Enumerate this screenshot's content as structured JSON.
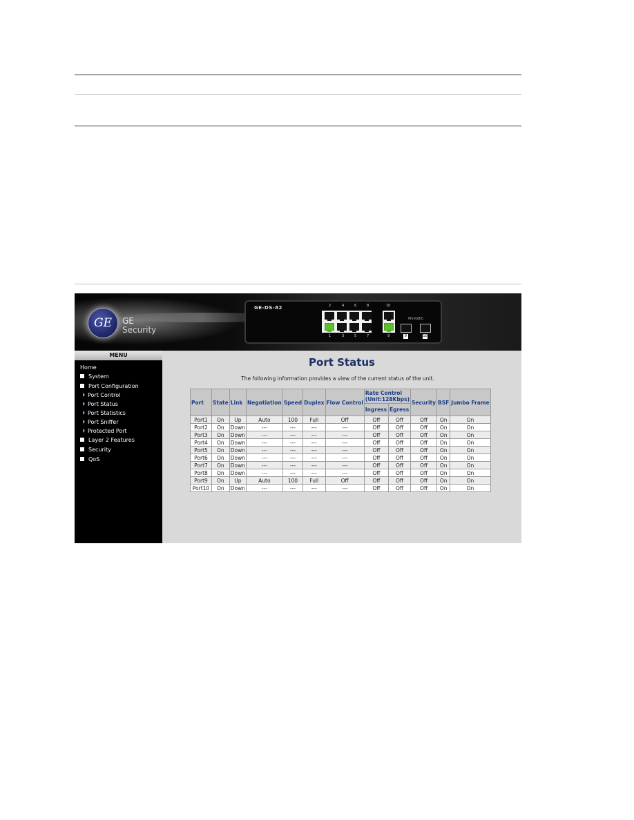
{
  "banner": {
    "logo_text": "GE",
    "brand_line1": "GE",
    "brand_line2": "Security",
    "device_model": "GE-DS-82",
    "top_port_numbers": [
      "2",
      "4",
      "6",
      "8",
      "10"
    ],
    "bottom_port_numbers": [
      "1",
      "3",
      "5",
      "7",
      "9"
    ],
    "gbic_label": "MiniGBIC",
    "sfp_labels": [
      "9",
      "10"
    ],
    "active_ports": [
      1,
      9
    ],
    "active_color": "#5cc22a"
  },
  "menu": {
    "header": "MENU",
    "items": [
      {
        "label": "Home",
        "type": "root"
      },
      {
        "label": "System",
        "type": "collapsed"
      },
      {
        "label": "Port Configuration",
        "type": "expanded"
      },
      {
        "label": "Port Control",
        "type": "sub"
      },
      {
        "label": "Port Status",
        "type": "sub"
      },
      {
        "label": "Port Statistics",
        "type": "sub"
      },
      {
        "label": "Port Sniffer",
        "type": "sub"
      },
      {
        "label": "Protected Port",
        "type": "sub"
      },
      {
        "label": "Layer 2 Features",
        "type": "collapsed"
      },
      {
        "label": "Security",
        "type": "collapsed"
      },
      {
        "label": "QoS",
        "type": "collapsed"
      }
    ]
  },
  "main": {
    "title": "Port Status",
    "description": "The following information provides a view of the current status of the unit.",
    "table": {
      "headers": {
        "port": "Port",
        "state": "State",
        "link": "Link",
        "negotiation": "Negotiation",
        "speed": "Speed",
        "duplex": "Duplex",
        "flow_control": "Flow Control",
        "rate_control_line1": "Rate Control",
        "rate_control_line2": "(Unit:128Kbps)",
        "ingress": "Ingress",
        "egress": "Egress",
        "security": "Security",
        "bsf": "BSF",
        "jumbo_frame": "Jumbo Frame"
      },
      "rows": [
        [
          "Port1",
          "On",
          "Up",
          "Auto",
          "100",
          "Full",
          "Off",
          "Off",
          "Off",
          "Off",
          "On",
          "On"
        ],
        [
          "Port2",
          "On",
          "Down",
          "---",
          "---",
          "---",
          "---",
          "Off",
          "Off",
          "Off",
          "On",
          "On"
        ],
        [
          "Port3",
          "On",
          "Down",
          "---",
          "---",
          "---",
          "---",
          "Off",
          "Off",
          "Off",
          "On",
          "On"
        ],
        [
          "Port4",
          "On",
          "Down",
          "---",
          "---",
          "---",
          "---",
          "Off",
          "Off",
          "Off",
          "On",
          "On"
        ],
        [
          "Port5",
          "On",
          "Down",
          "---",
          "---",
          "---",
          "---",
          "Off",
          "Off",
          "Off",
          "On",
          "On"
        ],
        [
          "Port6",
          "On",
          "Down",
          "---",
          "---",
          "---",
          "---",
          "Off",
          "Off",
          "Off",
          "On",
          "On"
        ],
        [
          "Port7",
          "On",
          "Down",
          "---",
          "---",
          "---",
          "---",
          "Off",
          "Off",
          "Off",
          "On",
          "On"
        ],
        [
          "Port8",
          "On",
          "Down",
          "---",
          "---",
          "---",
          "---",
          "Off",
          "Off",
          "Off",
          "On",
          "On"
        ],
        [
          "Port9",
          "On",
          "Up",
          "Auto",
          "100",
          "Full",
          "Off",
          "Off",
          "Off",
          "Off",
          "On",
          "On"
        ],
        [
          "Port10",
          "On",
          "Down",
          "---",
          "---",
          "---",
          "---",
          "Off",
          "Off",
          "Off",
          "On",
          "On"
        ]
      ]
    }
  }
}
